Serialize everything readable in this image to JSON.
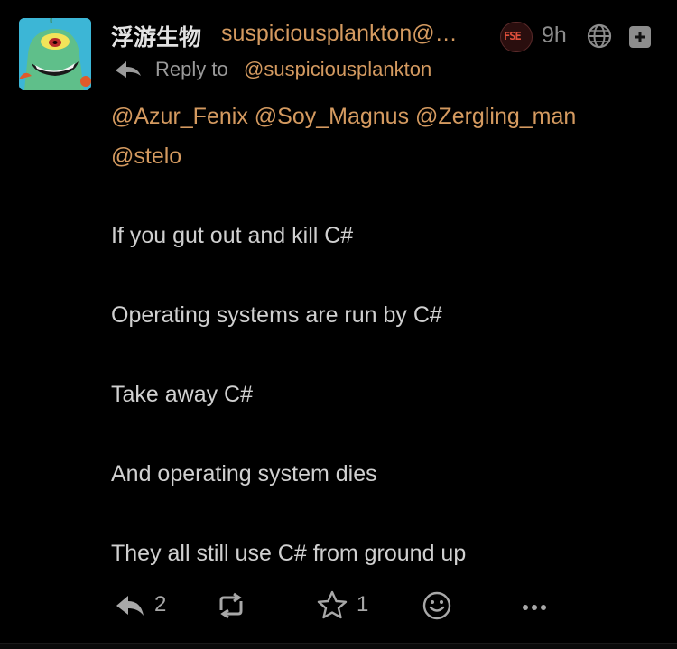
{
  "post": {
    "display_name": "浮游生物",
    "handle": "suspiciousplankton@…",
    "instance_badge": "FSE",
    "timestamp": "9h",
    "visibility_icon": "globe-icon",
    "reply_label": "Reply to",
    "reply_handle": "@suspiciousplankton",
    "mentions": [
      "@Azur_Fenix",
      "@Soy_Magnus",
      "@Zergling_man",
      "@stelo"
    ],
    "paragraphs": [
      "If you gut out and kill C#",
      "Operating systems are run by C#",
      "Take away C#",
      "And operating system dies",
      "They all still use C# from ground up"
    ]
  },
  "actions": {
    "reply_count": "2",
    "renote_count": "",
    "like_count": "1"
  },
  "colors": {
    "background": "#000000",
    "accent": "#d49a60",
    "text": "#d0d0d0",
    "muted": "#8c8c8c"
  }
}
